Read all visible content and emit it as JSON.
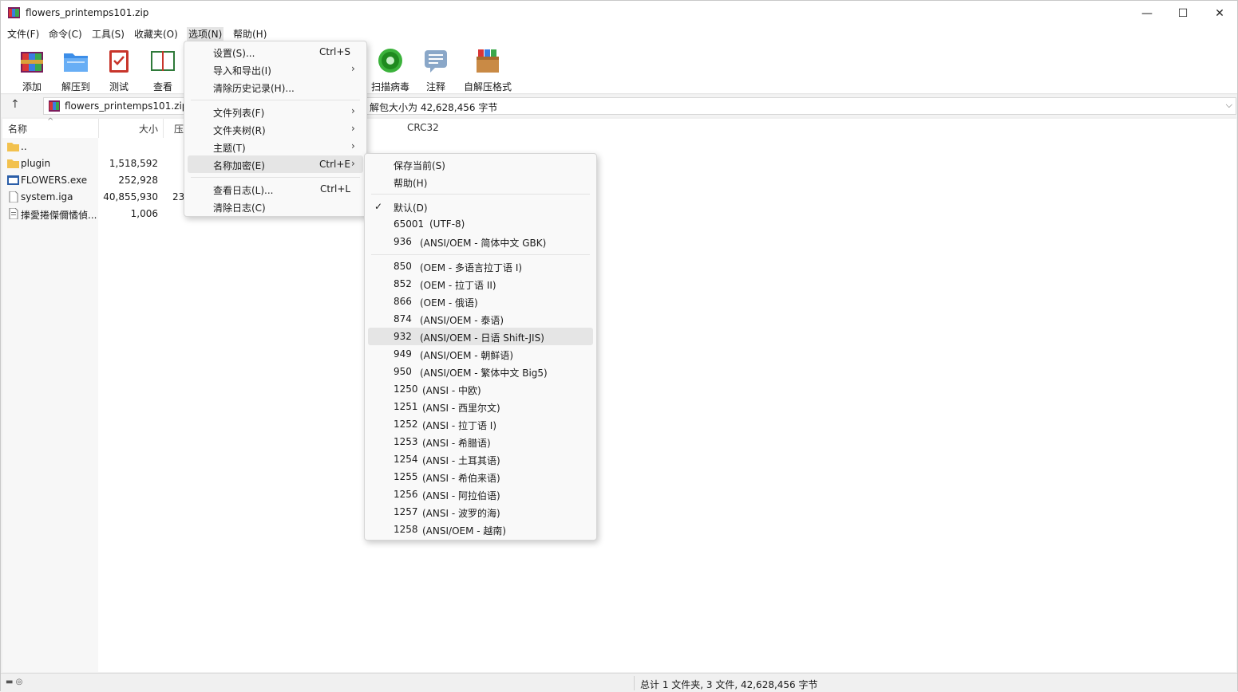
{
  "window": {
    "title": "flowers_printemps101.zip",
    "controls": {
      "minimize": "—",
      "maximize": "☐",
      "close": "✕"
    }
  },
  "menubar": [
    "文件(F)",
    "命令(C)",
    "工具(S)",
    "收藏夹(O)",
    "选项(N)",
    "帮助(H)"
  ],
  "toolbar": [
    {
      "label": "添加",
      "icon": "add-archive-icon"
    },
    {
      "label": "解压到",
      "icon": "extract-folder-icon"
    },
    {
      "label": "测试",
      "icon": "test-clipboard-icon"
    },
    {
      "label": "查看",
      "icon": "view-book-icon"
    },
    {
      "label": "扫描病毒",
      "icon": "virus-scan-icon"
    },
    {
      "label": "注释",
      "icon": "comment-icon"
    },
    {
      "label": "自解压格式",
      "icon": "sfx-box-icon"
    }
  ],
  "address": {
    "up": "↑",
    "path": "flowers_printemps101.zip",
    "tail": "解包大小为 42,628,456 字节",
    "dropdown": "⌵"
  },
  "filelist": {
    "columns": {
      "name": "名称",
      "size": "大小",
      "packed": "压",
      "crc": "CRC32"
    },
    "rows": [
      {
        "name": "..",
        "size": "",
        "packed": "",
        "icon": "folder-up-icon"
      },
      {
        "name": "plugin",
        "size": "1,518,592",
        "packed": "",
        "icon": "folder-icon"
      },
      {
        "name": "FLOWERS.exe",
        "size": "252,928",
        "packed": "",
        "icon": "exe-icon"
      },
      {
        "name": "system.iga",
        "size": "40,855,930",
        "packed": "23",
        "icon": "file-icon"
      },
      {
        "name": "搼愛捲傑儞憰偵...",
        "size": "1,006",
        "packed": "",
        "icon": "text-file-icon"
      }
    ]
  },
  "options_menu": {
    "items": [
      {
        "label": "设置(S)...",
        "shortcut": "Ctrl+S",
        "arrow": ""
      },
      {
        "label": "导入和导出(I)",
        "shortcut": "",
        "arrow": "›"
      },
      {
        "label": "清除历史记录(H)...",
        "shortcut": "",
        "arrow": ""
      },
      {
        "label": "文件列表(F)",
        "shortcut": "",
        "arrow": "›"
      },
      {
        "label": "文件夹树(R)",
        "shortcut": "",
        "arrow": "›"
      },
      {
        "label": "主题(T)",
        "shortcut": "",
        "arrow": "›"
      },
      {
        "label": "名称加密(E)",
        "shortcut": "Ctrl+E",
        "arrow": "›"
      },
      {
        "label": "查看日志(L)...",
        "shortcut": "Ctrl+L",
        "arrow": ""
      },
      {
        "label": "清除日志(C)",
        "shortcut": "",
        "arrow": ""
      }
    ]
  },
  "encoding_menu": {
    "top": [
      "保存当前(S)",
      "帮助(H)"
    ],
    "check": "✓",
    "group1": [
      {
        "code": "默认(D)",
        "desc": ""
      },
      {
        "code": "65001",
        "desc": "(UTF-8)"
      },
      {
        "code": "936",
        "desc": "(ANSI/OEM - 简体中文 GBK)"
      }
    ],
    "group2": [
      {
        "code": "850",
        "desc": "(OEM - 多语言拉丁语 I)"
      },
      {
        "code": "852",
        "desc": "(OEM - 拉丁语 II)"
      },
      {
        "code": "866",
        "desc": "(OEM - 俄语)"
      },
      {
        "code": "874",
        "desc": "(ANSI/OEM - 泰语)"
      },
      {
        "code": "932",
        "desc": "(ANSI/OEM - 日语 Shift-JIS)"
      },
      {
        "code": "949",
        "desc": "(ANSI/OEM - 朝鲜语)"
      },
      {
        "code": "950",
        "desc": "(ANSI/OEM - 繁体中文 Big5)"
      },
      {
        "code": "1250",
        "desc": "(ANSI - 中欧)"
      },
      {
        "code": "1251",
        "desc": "(ANSI - 西里尔文)"
      },
      {
        "code": "1252",
        "desc": "(ANSI - 拉丁语 I)"
      },
      {
        "code": "1253",
        "desc": "(ANSI - 希腊语)"
      },
      {
        "code": "1254",
        "desc": "(ANSI - 土耳其语)"
      },
      {
        "code": "1255",
        "desc": "(ANSI - 希伯来语)"
      },
      {
        "code": "1256",
        "desc": "(ANSI - 阿拉伯语)"
      },
      {
        "code": "1257",
        "desc": "(ANSI - 波罗的海)"
      },
      {
        "code": "1258",
        "desc": "(ANSI/OEM - 越南)"
      }
    ]
  },
  "statusbar": {
    "icons": "▬ ◎",
    "summary": "总计 1 文件夹, 3 文件, 42,628,456 字节"
  }
}
